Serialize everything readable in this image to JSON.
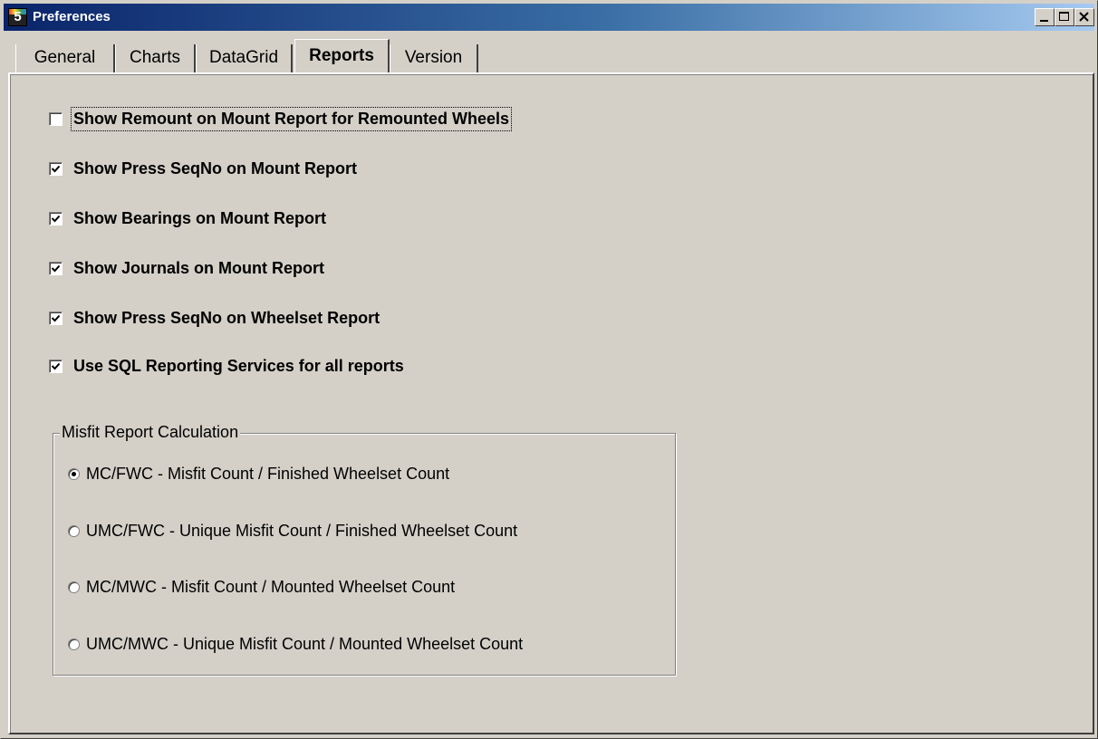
{
  "window": {
    "title": "Preferences",
    "icon_label": "5",
    "controls": [
      "minimize-icon",
      "maximize-icon",
      "close-icon"
    ]
  },
  "tabs": [
    {
      "label": "General",
      "active": false
    },
    {
      "label": "Charts",
      "active": false
    },
    {
      "label": "DataGrid",
      "active": false
    },
    {
      "label": "Reports",
      "active": true
    },
    {
      "label": "Version",
      "active": false
    }
  ],
  "options": [
    {
      "label": "Show Remount on Mount Report for Remounted Wheels",
      "checked": false,
      "focused": true
    },
    {
      "label": "Show Press SeqNo on Mount Report",
      "checked": true
    },
    {
      "label": "Show Bearings on Mount Report",
      "checked": true
    },
    {
      "label": "Show Journals on Mount Report",
      "checked": true
    },
    {
      "label": "Show Press SeqNo on Wheelset Report",
      "checked": true
    },
    {
      "label": "Use SQL Reporting Services for all reports",
      "checked": true
    }
  ],
  "misfit": {
    "legend": "Misfit Report Calculation",
    "options": [
      {
        "label": "MC/FWC - Misfit Count / Finished Wheelset Count",
        "selected": true
      },
      {
        "label": "UMC/FWC - Unique Misfit Count / Finished Wheelset Count",
        "selected": false
      },
      {
        "label": "MC/MWC - Misfit Count / Mounted Wheelset Count",
        "selected": false
      },
      {
        "label": "UMC/MWC - Unique Misfit Count / Mounted Wheelset Count",
        "selected": false
      }
    ]
  },
  "colors": {
    "titlebar_start": "#0a246a",
    "titlebar_end": "#a6caf0",
    "face": "#d4d0c8"
  }
}
